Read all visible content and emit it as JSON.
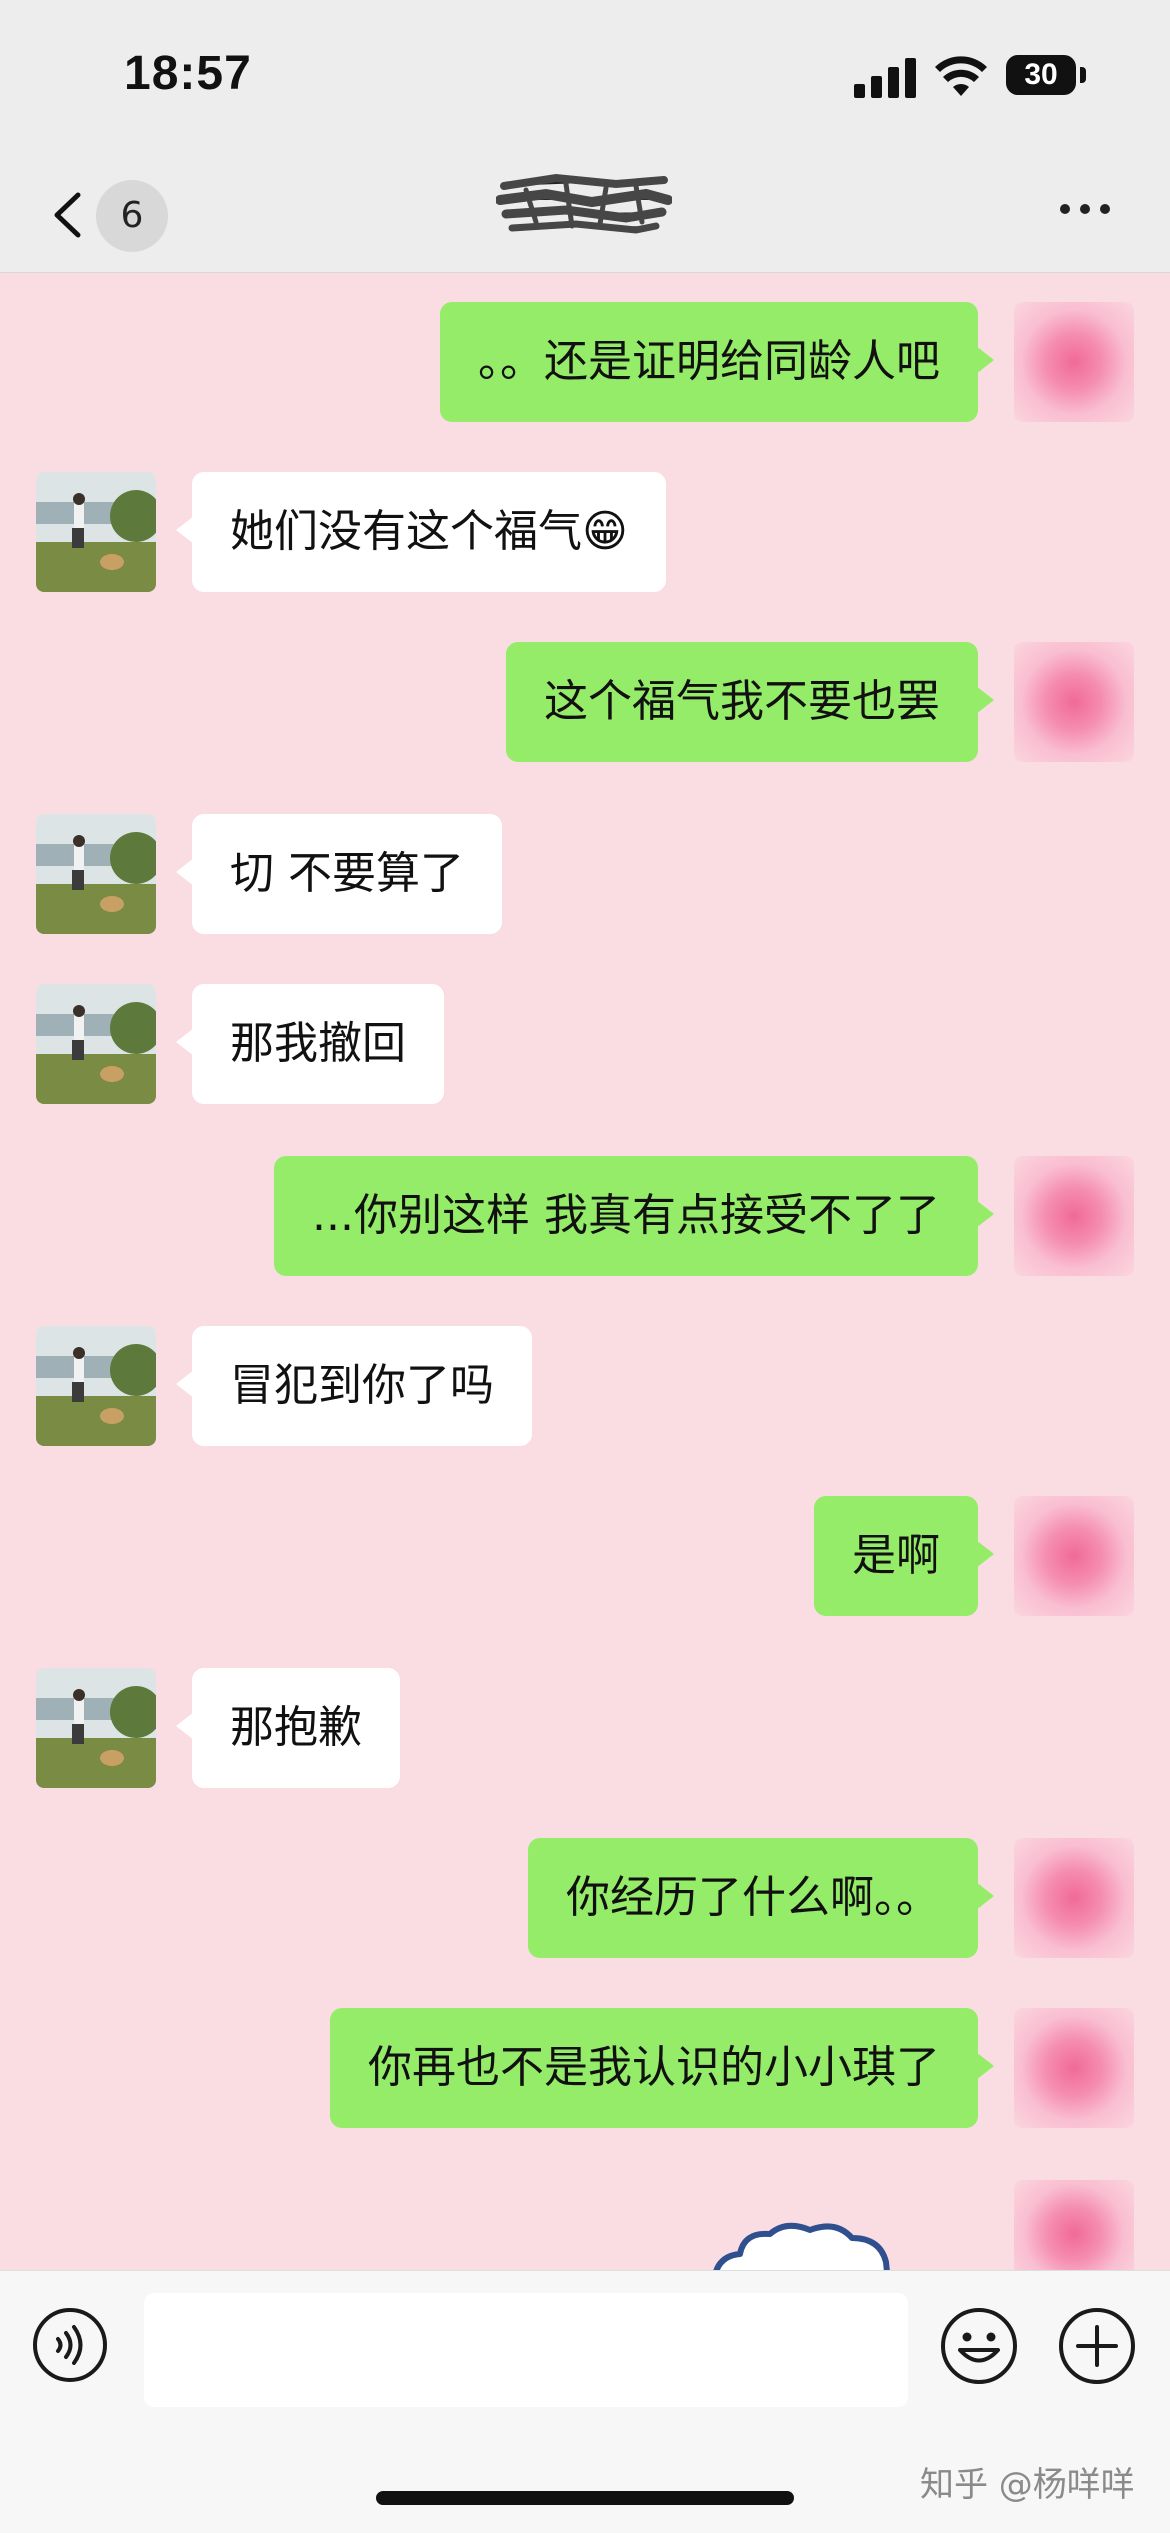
{
  "status_bar": {
    "time": "18:57",
    "battery": "30",
    "icons": [
      "signal-icon",
      "wifi-icon",
      "battery-icon"
    ]
  },
  "nav": {
    "unread_count": "6",
    "icons": [
      "back-chevron-icon",
      "more-icon"
    ]
  },
  "colors": {
    "chat_background": "#fadde3",
    "my_bubble": "#95ec69",
    "their_bubble": "#ffffff"
  },
  "messages": [
    {
      "from": "me",
      "text": "。。还是证明给同龄人吧"
    },
    {
      "from": "other",
      "text": "她们没有这个福气😁"
    },
    {
      "from": "me",
      "text": "这个福气我不要也罢"
    },
    {
      "from": "other",
      "text": "切 不要算了"
    },
    {
      "from": "other",
      "text": "那我撤回"
    },
    {
      "from": "me",
      "text": "...你别这样 我真有点接受不了了"
    },
    {
      "from": "other",
      "text": "冒犯到你了吗"
    },
    {
      "from": "me",
      "text": "是啊"
    },
    {
      "from": "other",
      "text": "那抱歉"
    },
    {
      "from": "me",
      "text": "你经历了什么啊。。"
    },
    {
      "from": "me",
      "text": "你再也不是我认识的小小琪了"
    }
  ],
  "input_bar": {
    "icons": [
      "voice-icon",
      "emoji-icon",
      "plus-icon"
    ],
    "placeholder": ""
  },
  "watermark": "知乎 @杨咩咩"
}
